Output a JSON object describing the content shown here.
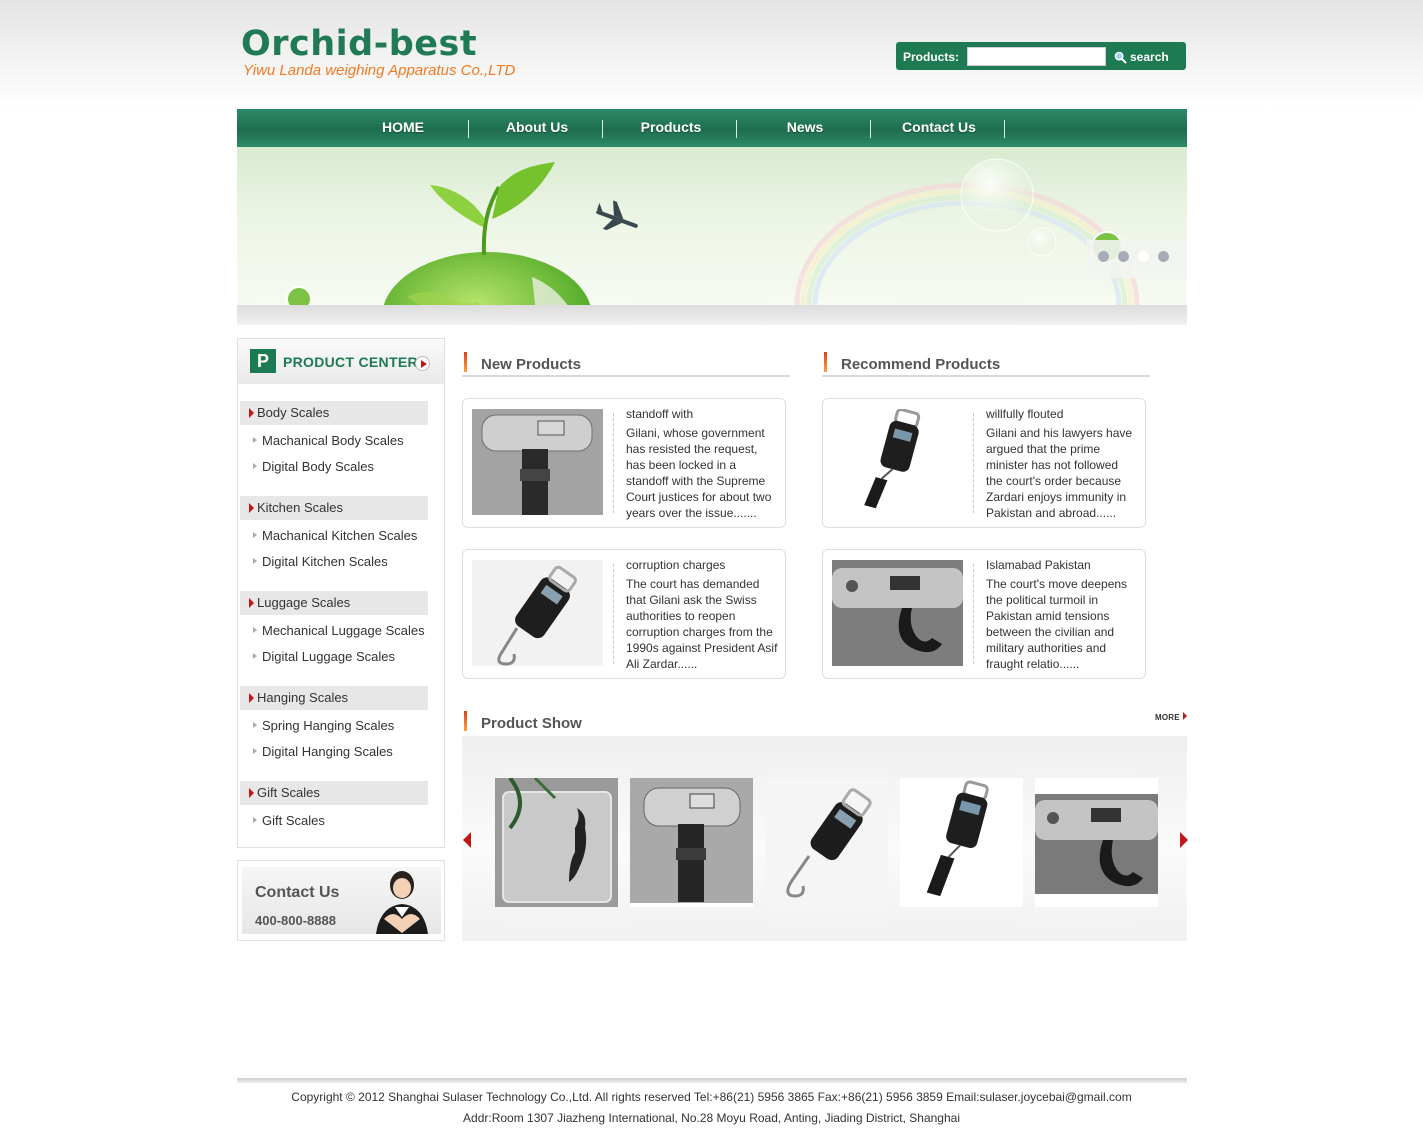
{
  "header": {
    "logo_title": "Orchid-best",
    "logo_subtitle": "Yiwu Landa weighing Apparatus Co.,LTD",
    "search_label": "Products:",
    "search_placeholder": "",
    "search_button": "search"
  },
  "nav": {
    "items": [
      "HOME",
      "About Us",
      "Products",
      "News",
      "Contact Us"
    ]
  },
  "banner": {
    "slide_count": 4,
    "active_slide": 3
  },
  "sidebar": {
    "title": "PRODUCT CENTER",
    "categories": [
      {
        "label": "Body Scales",
        "subs": [
          "Machanical Body Scales",
          "Digital Body Scales"
        ]
      },
      {
        "label": "Kitchen Scales",
        "subs": [
          "Machanical Kitchen Scales",
          "Digital Kitchen Scales"
        ]
      },
      {
        "label": "Luggage Scales",
        "subs": [
          "Mechanical Luggage Scales",
          "Digital Luggage Scales"
        ]
      },
      {
        "label": "Hanging Scales",
        "subs": [
          "Spring Hanging Scales",
          "Digital Hanging Scales"
        ]
      },
      {
        "label": "Gift Scales",
        "subs": [
          "Gift Scales"
        ]
      }
    ],
    "contact_title": "Contact Us",
    "contact_phone": "400-800-8888"
  },
  "new_products": {
    "title": "New Products",
    "cards": [
      {
        "title": "standoff with",
        "text": "Gilani, whose government has resisted the request, has been locked in a standoff with the Supreme Court justices for about two years over the issue......."
      },
      {
        "title": "corruption charges",
        "text": "The court has demanded that Gilani ask the Swiss authorities to reopen corruption charges from the 1990s against President Asif Ali Zardar......"
      }
    ]
  },
  "recommend_products": {
    "title": "Recommend Products",
    "cards": [
      {
        "title": "willfully flouted",
        "text": "Gilani and his lawyers have argued that the prime minister has not followed the court's order because Zardari enjoys immunity in Pakistan and abroad......"
      },
      {
        "title": "Islamabad Pakistan",
        "text": "The court's move deepens the political turmoil in Pakistan amid tensions between the civilian and military authorities and fraught relatio......"
      }
    ]
  },
  "product_show": {
    "title": "Product Show",
    "more_label": "MORE"
  },
  "footer": {
    "line1": "Copyright © 2012 Shanghai Sulaser Technology Co.,Ltd.  All rights reserved  Tel:+86(21) 5956 3865   Fax:+86(21) 5956 3859   Email:sulaser.joycebai@gmail.com",
    "line2": "Addr:Room 1307 Jiazheng International, No.28 Moyu Road, Anting, Jiading District, Shanghai"
  },
  "colors": {
    "brand_green": "#1d7a53",
    "accent_orange": "#f07a22",
    "accent_red": "#c0171a"
  }
}
